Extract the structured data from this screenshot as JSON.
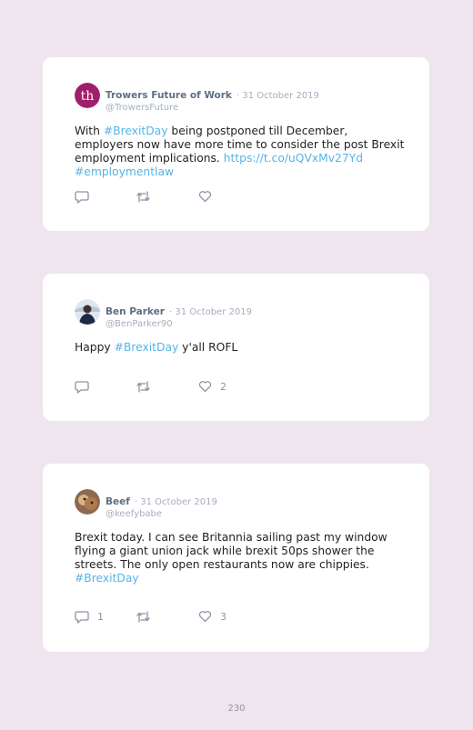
{
  "tweets": [
    {
      "name": "Trowers Future of Work",
      "date": "· 31 October 2019",
      "handle": "@TrowersFuture",
      "avatar_text": "th",
      "avatar_color": "#a01f6b",
      "body": [
        {
          "text": "With "
        },
        {
          "text": "#BrexitDay",
          "link": true
        },
        {
          "text": " being postponed till December, employers now have more time to consider the post Brexit employment implications. "
        },
        {
          "text": "https://t.co/uQVxMv27Yd",
          "link": true
        },
        {
          "text": " "
        },
        {
          "text": "#employmentlaw",
          "link": true
        }
      ],
      "replies": "",
      "retweets": "",
      "likes": ""
    },
    {
      "name": "Ben Parker",
      "date": "· 31 October 2019",
      "handle": "@BenParker90",
      "avatar_text": "",
      "avatar_color": "#dfe6ee",
      "body": [
        {
          "text": "Happy "
        },
        {
          "text": "#BrexitDay",
          "link": true
        },
        {
          "text": " y'all ROFL"
        }
      ],
      "replies": "",
      "retweets": "",
      "likes": "2"
    },
    {
      "name": "Beef",
      "date": "· 31 October 2019",
      "handle": "@keefybabe",
      "avatar_text": "",
      "avatar_color": "#8c6a4f",
      "body": [
        {
          "text": "Brexit today. I can see Britannia sailing past my window flying a giant union jack while brexit 50ps shower the streets. The only open restaurants now are chippies. "
        },
        {
          "text": "#BrexitDay",
          "link": true
        }
      ],
      "replies": "1",
      "retweets": "",
      "likes": "3"
    }
  ],
  "page_number": "230",
  "colors": {
    "background": "#efe5ee",
    "card": "#ffffff",
    "link": "#55b4e8",
    "name": "#5f6f86",
    "muted": "#a5afbd"
  },
  "icons": [
    "reply-icon",
    "retweet-icon",
    "like-icon"
  ]
}
